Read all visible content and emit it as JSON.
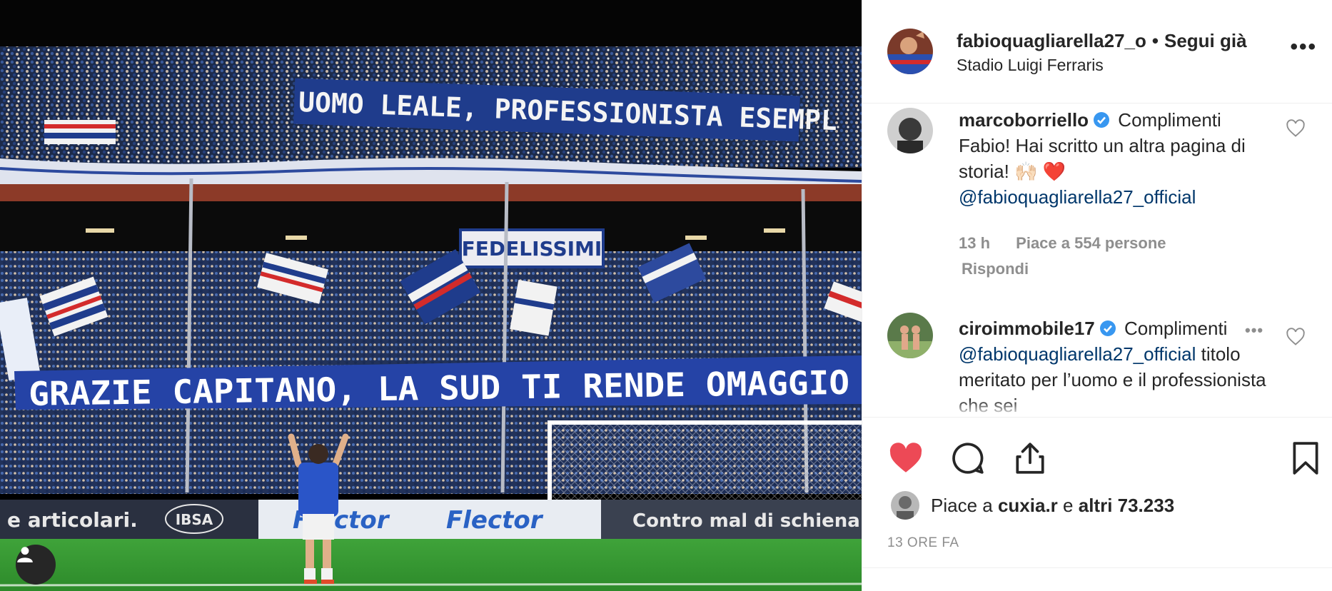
{
  "photo": {
    "banner_top": "UOMO LEALE, PROFESSIONISTA ESEMPL",
    "banner_middle": "FEDELISSIMI",
    "banner_main": "GRAZIE CAPITANO, LA SUD TI RENDE OMAGGIO",
    "ads": [
      "e articolari.",
      "IBSA",
      "Flector",
      "Flector",
      "Contro mal di schiena"
    ],
    "user_tag_icon": "person-icon"
  },
  "post": {
    "author": "fabioquagliarella27_o",
    "separator": "•",
    "follow_label": "Segui già",
    "location": "Stadio Luigi Ferraris",
    "more_icon": "•••"
  },
  "comments": [
    {
      "user": "marcoborriello",
      "text": "Complimenti Fabio! Hai scritto un altra pagina di storia! 🙌🏻 ❤️",
      "mention": "@fabioquagliarella27_official",
      "time": "13 h",
      "likes": "Piace a 554 persone",
      "reply": "Rispondi"
    },
    {
      "user": "ciroimmobile17",
      "text": "Complimenti",
      "mention": "@fabioquagliarella27_official",
      "text_after": "titolo meritato per l’uomo e il professionista che sei",
      "more_icon": "•••"
    }
  ],
  "likes": {
    "prefix": "Piace a",
    "user": "cuxia.r",
    "conj": "e",
    "others": "altri 73.233"
  },
  "time_ago": "13 ORE FA",
  "colors": {
    "like_red": "#ed4956",
    "verified_blue": "#3897f0",
    "mention_blue": "#00376b",
    "muted": "#8e8e8e"
  }
}
